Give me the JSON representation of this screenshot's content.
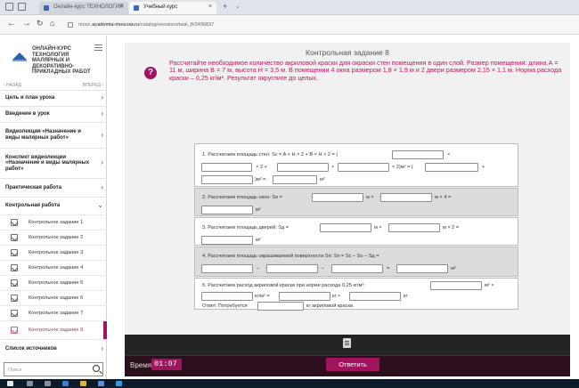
{
  "browser": {
    "tab1_title": "Онлайн-курс ТЕХНОЛОГИЯ",
    "tab2_title": "Учебный курс",
    "url_prefix": "mooc.",
    "url_domain": "academia-moscow.ru",
    "url_path": "/catalog/sessions/task_8/3496837"
  },
  "sidebar": {
    "logo_text": "ОНЛАЙН-КУРС ТЕХНОЛОГИЯ МАЛЯРНЫХ И ДЕКОРАТИВНО-ПРИКЛАДНЫХ РАБОТ",
    "back": "НАЗАД",
    "forward": "ВПЕРЕД",
    "sections": [
      "Цель и план урока",
      "Введение в урок",
      "Видеолекция «Назначение и виды малярных работ»",
      "Конспект видеолекции «Назначение и виды малярных работ»",
      "Практическая работа",
      "Контрольная работа"
    ],
    "subitems": [
      "Контрольное задание 1",
      "Контрольное задание 2",
      "Контрольное задание 3",
      "Контрольное задание 4",
      "Контрольное задание 5",
      "Контрольное задание 6",
      "Контрольное задание 7",
      "Контрольное задание 8"
    ],
    "sources": "Список источников",
    "search_placeholder": "Поиск"
  },
  "task": {
    "title": "Контрольная задание 8",
    "text": "Рассчитайте необходимое количество акриловой краски для окраски стен помещения в один слой. Размер помещения: длина А = 11 м, ширина В = 7 м, высота Н = 3,5 м. В помещении 4 окна размером 1,8 × 1,9 м и 2 двери размером 2,15 × 1,1 м. Норма расхода краски – 0,25 кг/м². Результат округлите до целых.",
    "step1": {
      "label": "1. Рассчитаем площадь стен: Sc = A × H × 2 + B × H × 2 = (",
      "times": "×",
      "x2plus": "× 2 +",
      "x2m": "× 2)м² = (",
      "plus": "+",
      "m2eq": ")м² =",
      "m2": "м²"
    },
    "step2": {
      "label": "2. Рассчитаем площадь окон: So =",
      "m_x": "м ×",
      "m_x4": "м × 4 =",
      "m2": "м²"
    },
    "step3": {
      "label": "3. Рассчитаем площадь дверей: Sд =",
      "m_x": "м ×",
      "m_x2": "м × 2 =",
      "m2": "м²"
    },
    "step4": {
      "label": "4. Рассчитаем площадь окрашиваемой поверхности Sп: Sп = Sc – So – Sд =",
      "minus": "–",
      "eq": "=",
      "m2": "м²"
    },
    "step5": {
      "label": "5. Рассчитаем расход акриловой краски при норме расхода 0,25 кг/м²:",
      "m2x": "м² ×",
      "kgm2": "кг/м² =",
      "kg_eq": "кг ≈",
      "kg": "кг",
      "answer": "Ответ. Потребуется",
      "answer_tail": "кг акриловой краски."
    }
  },
  "footer": {
    "time_label": "Время",
    "time_value": "01:07",
    "answer_button": "Ответить"
  },
  "colors": {
    "accent": "#a0145e",
    "task_text": "#c0185c"
  }
}
